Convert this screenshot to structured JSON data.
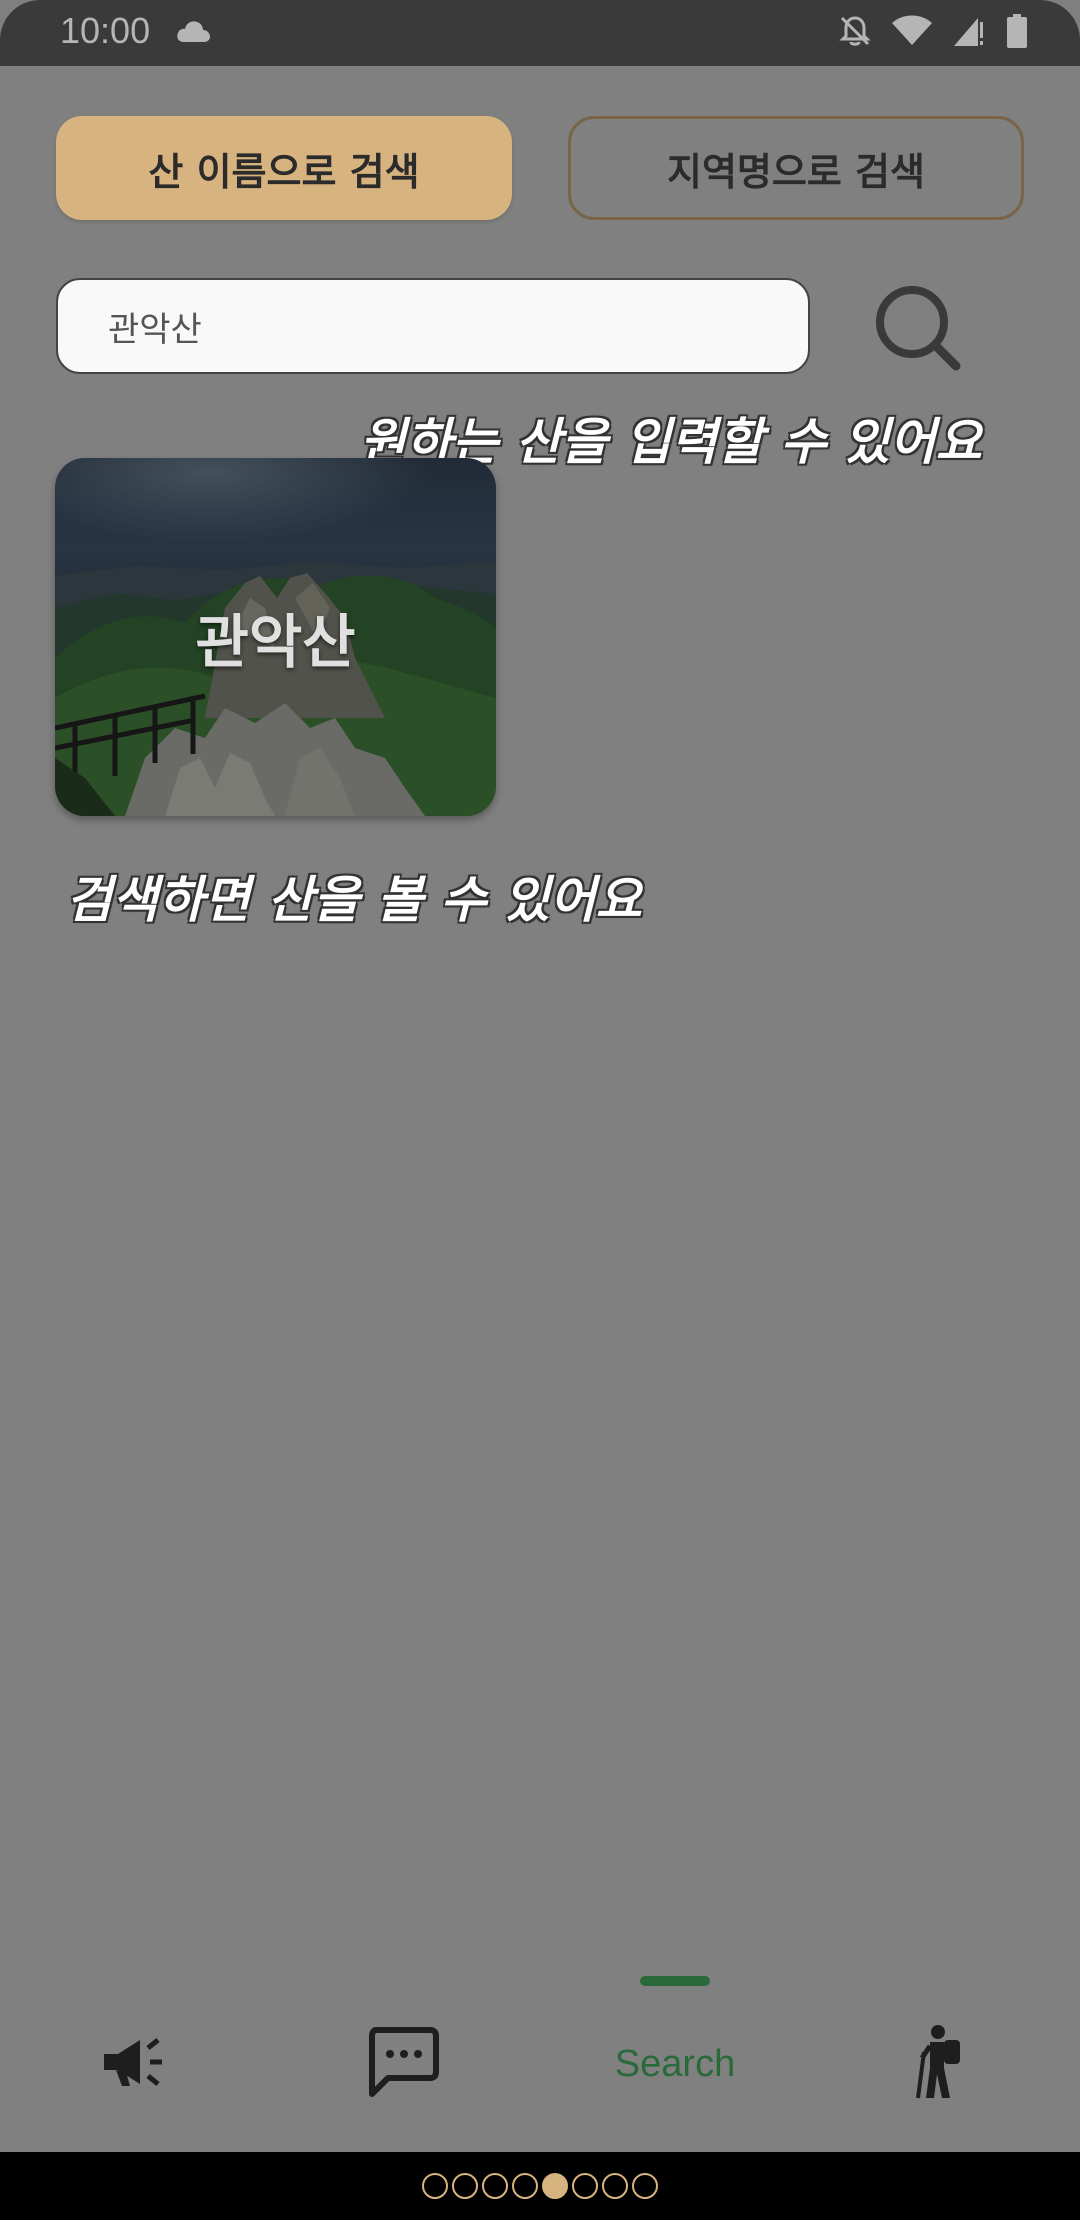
{
  "status_bar": {
    "time": "10:00",
    "icons": [
      "cloud-icon",
      "notifications-off-icon",
      "wifi-icon",
      "signal-icon",
      "battery-icon"
    ]
  },
  "toggle": {
    "mountain_name_label": "산 이름으로 검색",
    "region_name_label": "지역명으로 검색",
    "active_color": "#d7b37f"
  },
  "search": {
    "value": "관악산",
    "icon": "search-icon"
  },
  "hints": {
    "input_hint": "원하는 산을 입력할 수 있어요",
    "result_hint": "검색하면 산을 볼 수 있어요"
  },
  "results": [
    {
      "name": "관악산"
    }
  ],
  "bottom_nav": {
    "items": [
      {
        "icon": "megaphone-icon",
        "label": ""
      },
      {
        "icon": "chat-icon",
        "label": ""
      },
      {
        "icon": "search-tab",
        "label": "Search",
        "active": true
      },
      {
        "icon": "hiker-icon",
        "label": ""
      }
    ],
    "active_color": "#2a6a3a"
  },
  "pager": {
    "total": 8,
    "current": 5,
    "color": "#d7b37f"
  }
}
